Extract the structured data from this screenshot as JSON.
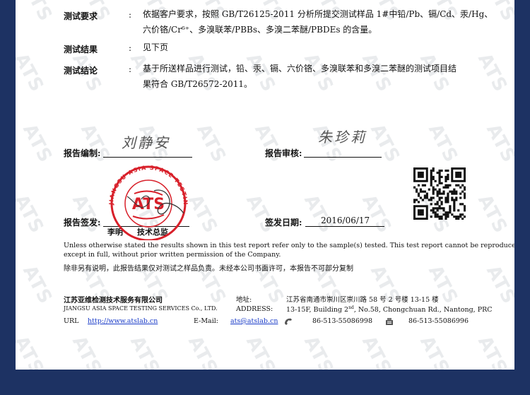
{
  "fields": {
    "requirements": {
      "label": "测试要求",
      "colon": ":",
      "line1": "依据客户要求，按照 GB/T26125-2011 分析所提交测试样品 1#中铅/Pb、镉/Cd、汞/Hg、",
      "line2": "六价铬/Cr⁶⁺、多溴联苯/PBBs、多溴二苯醚/PBDEs 的含量。"
    },
    "results": {
      "label": "测试结果",
      "colon": ":",
      "value": "见下页"
    },
    "conclusion": {
      "label": "测试结论",
      "colon": ":",
      "line1": "基于所送样品进行测试，铅、汞、镉、六价铬、多溴联苯和多溴二苯醚的测试项目结",
      "line2": "果符合 GB/T26572-2011。"
    }
  },
  "signatures": {
    "prepared_label": "报告编制:",
    "prepared_sig": "刘静安",
    "reviewed_label": "报告审核:",
    "reviewed_sig": "朱珍莉",
    "signed_label": "报告签发:",
    "signer_name": "李明",
    "signer_title": "技术总监",
    "date_label": "签发日期:",
    "date_value": "2016/06/17"
  },
  "stamp": {
    "text": "JIANGSU ASIA SPACE TESTING SERVICES",
    "logo": "ATS"
  },
  "disclaimer": {
    "en_line1": "Unless otherwise stated the results shown in this test report refer only to the sample(s) tested. This test report cannot be reproduced,",
    "en_line2": "except in full, without prior written permission of the Company.",
    "zh": "除非另有说明，此报告结果仅对测试之样品负责。未经本公司书面许可，本报告不可部分复制"
  },
  "company": {
    "name_zh": "江苏亚维检测技术服务有限公司",
    "name_en": "JIANGSU ASIA SPACE TESTING SERVICES Co., LTD.",
    "url_label": "URL",
    "url": "http://www.atslab.cn",
    "email_label": "E-Mail:",
    "email": "ats@atslab.cn",
    "address_zh_label": "地址:",
    "address_zh": "江苏省南通市崇川区崇川路 58 号 2 号楼 13-15 楼",
    "address_en_label": "ADDRESS:",
    "address_en_pre": "13-15F, Building 2",
    "address_en_sup": "nd",
    "address_en_post": ", No.58, Chongchuan Rd., Nantong, PRC",
    "phone": "86-513-55086998",
    "fax": "86-513-55086996"
  },
  "watermark": "ATS",
  "colors": {
    "background": "#1d3263",
    "stamp": "#d8202a",
    "link": "#1a3cc8"
  }
}
